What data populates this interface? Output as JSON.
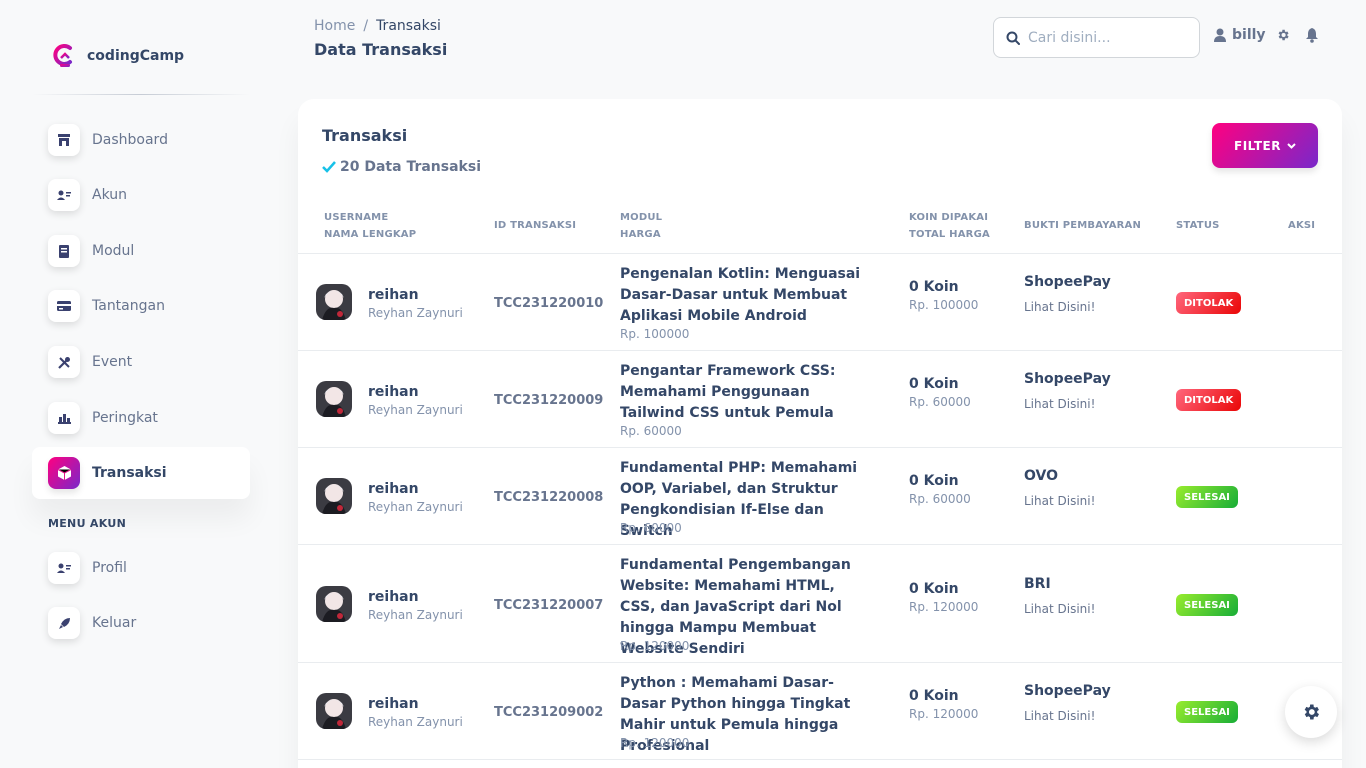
{
  "brand": {
    "name": "codingCamp"
  },
  "sidebar": {
    "items": [
      {
        "label": "Dashboard",
        "icon": "shop-icon"
      },
      {
        "label": "Akun",
        "icon": "user-card-icon"
      },
      {
        "label": "Modul",
        "icon": "book-icon"
      },
      {
        "label": "Tantangan",
        "icon": "credit-card-icon"
      },
      {
        "label": "Event",
        "icon": "tools-icon"
      },
      {
        "label": "Peringkat",
        "icon": "chart-icon"
      },
      {
        "label": "Transaksi",
        "icon": "box-icon",
        "active": true
      }
    ],
    "section_title": "MENU AKUN",
    "account_items": [
      {
        "label": "Profil",
        "icon": "user-card-icon"
      },
      {
        "label": "Keluar",
        "icon": "rocket-icon"
      }
    ]
  },
  "header": {
    "breadcrumb_home": "Home",
    "breadcrumb_sep": "/",
    "breadcrumb_current": "Transaksi",
    "title": "Data Transaksi",
    "search_placeholder": "Cari disini...",
    "username": "billy"
  },
  "card": {
    "title": "Transaksi",
    "subtitle": "20 Data Transaksi",
    "filter_label": "FILTER"
  },
  "table": {
    "headers": {
      "username": "USERNAME",
      "nama_lengkap": "NAMA LENGKAP",
      "id_transaksi": "ID TRANSAKSI",
      "modul": "MODUL",
      "harga": "HARGA",
      "koin": "KOIN DIPAKAI",
      "total_harga": "TOTAL HARGA",
      "bukti": "BUKTI PEMBAYARAN",
      "status": "STATUS",
      "aksi": "AKSI"
    },
    "rows": [
      {
        "username": "reihan",
        "fullname": "Reyhan Zaynuri",
        "id": "TCC231220010",
        "modul": "Pengenalan Kotlin: Menguasai Dasar-Dasar untuk Membuat Aplikasi Mobile Android",
        "harga": "Rp. 100000",
        "koin": "0 Koin",
        "total": "Rp. 100000",
        "bayar": "ShopeePay",
        "lihat": "Lihat Disini!",
        "status": "DITOLAK"
      },
      {
        "username": "reihan",
        "fullname": "Reyhan Zaynuri",
        "id": "TCC231220009",
        "modul": "Pengantar Framework CSS: Memahami Penggunaan Tailwind CSS untuk Pemula",
        "harga": "Rp. 60000",
        "koin": "0 Koin",
        "total": "Rp. 60000",
        "bayar": "ShopeePay",
        "lihat": "Lihat Disini!",
        "status": "DITOLAK"
      },
      {
        "username": "reihan",
        "fullname": "Reyhan Zaynuri",
        "id": "TCC231220008",
        "modul": "Fundamental PHP: Memahami OOP, Variabel, dan Struktur Pengkondisian If-Else dan Switch",
        "harga": "Rp. 60000",
        "koin": "0 Koin",
        "total": "Rp. 60000",
        "bayar": "OVO",
        "lihat": "Lihat Disini!",
        "status": "SELESAI"
      },
      {
        "username": "reihan",
        "fullname": "Reyhan Zaynuri",
        "id": "TCC231220007",
        "modul": "Fundamental Pengembangan Website: Memahami HTML, CSS, dan JavaScript dari Nol hingga Mampu Membuat Website Sendiri",
        "harga": "Rp. 120000",
        "koin": "0 Koin",
        "total": "Rp. 120000",
        "bayar": "BRI",
        "lihat": "Lihat Disini!",
        "status": "SELESAI"
      },
      {
        "username": "reihan",
        "fullname": "Reyhan Zaynuri",
        "id": "TCC231209002",
        "modul": "Python : Memahami Dasar-Dasar Python hingga Tingkat Mahir untuk Pemula hingga Profesional",
        "harga": "Rp. 120000",
        "koin": "0 Koin",
        "total": "Rp. 120000",
        "bayar": "ShopeePay",
        "lihat": "Lihat Disini!",
        "status": "SELESAI"
      }
    ]
  }
}
